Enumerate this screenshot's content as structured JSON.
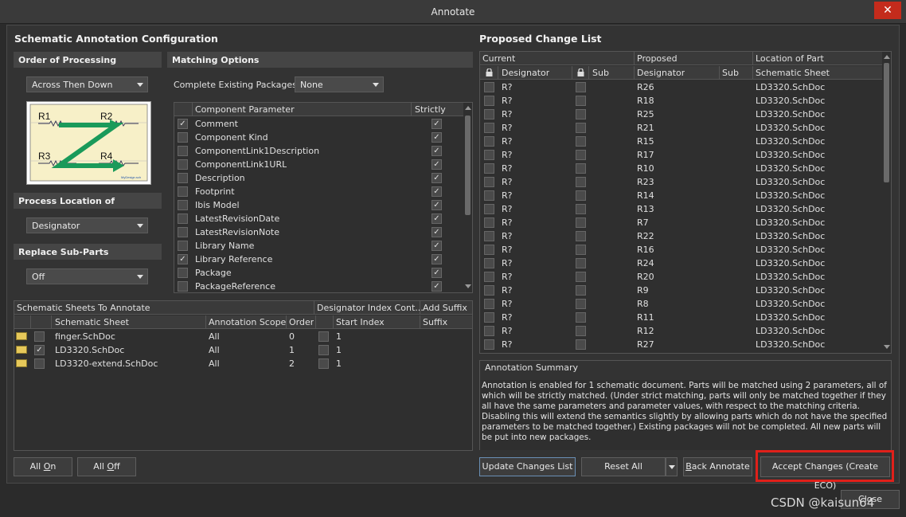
{
  "window": {
    "title": "Annotate",
    "close_glyph": "✕"
  },
  "left": {
    "title": "Schematic Annotation Configuration",
    "order": {
      "header": "Order of Processing",
      "value": "Across Then Down"
    },
    "preview": {
      "labels": [
        "R1",
        "R2",
        "R3",
        "R4"
      ],
      "caption": "MyDesign.sch"
    },
    "process_location": {
      "header": "Process Location of",
      "value": "Designator"
    },
    "replace_subparts": {
      "header": "Replace Sub-Parts",
      "value": "Off"
    },
    "matching": {
      "header": "Matching Options",
      "complete_label": "Complete Existing Packages",
      "complete_value": "None",
      "col_param": "Component Parameter",
      "col_strict": "Strictly",
      "params": [
        {
          "name": "Comment",
          "checked": true,
          "strict": true
        },
        {
          "name": "Component Kind",
          "checked": false,
          "strict": true
        },
        {
          "name": "ComponentLink1Description",
          "checked": false,
          "strict": true
        },
        {
          "name": "ComponentLink1URL",
          "checked": false,
          "strict": true
        },
        {
          "name": "Description",
          "checked": false,
          "strict": true
        },
        {
          "name": "Footprint",
          "checked": false,
          "strict": true
        },
        {
          "name": "Ibis Model",
          "checked": false,
          "strict": true
        },
        {
          "name": "LatestRevisionDate",
          "checked": false,
          "strict": true
        },
        {
          "name": "LatestRevisionNote",
          "checked": false,
          "strict": true
        },
        {
          "name": "Library Name",
          "checked": false,
          "strict": true
        },
        {
          "name": "Library Reference",
          "checked": true,
          "strict": true
        },
        {
          "name": "Package",
          "checked": false,
          "strict": true
        },
        {
          "name": "PackageReference",
          "checked": false,
          "strict": true
        }
      ]
    },
    "sheets": {
      "group1": "Schematic Sheets To Annotate",
      "group2": "Designator Index Cont...",
      "group3": "Add Suffix",
      "col_sheet": "Schematic Sheet",
      "col_scope": "Annotation Scope",
      "col_order": "Order",
      "col_start": "Start Index",
      "col_suffix": "Suffix",
      "rows": [
        {
          "sheet": "finger.SchDoc",
          "checked": false,
          "scope": "All",
          "order": "0",
          "start": "1"
        },
        {
          "sheet": "LD3320.SchDoc",
          "checked": true,
          "scope": "All",
          "order": "1",
          "start": "1"
        },
        {
          "sheet": "LD3320-extend.SchDoc",
          "checked": false,
          "scope": "All",
          "order": "2",
          "start": "1"
        }
      ]
    },
    "buttons": {
      "all_on_pre": "All ",
      "all_on_u": "O",
      "all_on_post": "n",
      "all_off_pre": "All ",
      "all_off_u": "O",
      "all_off_post": "ff"
    }
  },
  "right": {
    "title": "Proposed Change List",
    "groups": {
      "current": "Current",
      "proposed": "Proposed",
      "location": "Location of Part"
    },
    "cols": {
      "designator": "Designator",
      "sub": "Sub",
      "pdesignator": "Designator",
      "psub": "Sub",
      "sheet": "Schematic Sheet"
    },
    "rows": [
      {
        "cur": "R?",
        "prop": "R26",
        "sheet": "LD3320.SchDoc"
      },
      {
        "cur": "R?",
        "prop": "R18",
        "sheet": "LD3320.SchDoc"
      },
      {
        "cur": "R?",
        "prop": "R25",
        "sheet": "LD3320.SchDoc"
      },
      {
        "cur": "R?",
        "prop": "R21",
        "sheet": "LD3320.SchDoc"
      },
      {
        "cur": "R?",
        "prop": "R15",
        "sheet": "LD3320.SchDoc"
      },
      {
        "cur": "R?",
        "prop": "R17",
        "sheet": "LD3320.SchDoc"
      },
      {
        "cur": "R?",
        "prop": "R10",
        "sheet": "LD3320.SchDoc"
      },
      {
        "cur": "R?",
        "prop": "R23",
        "sheet": "LD3320.SchDoc"
      },
      {
        "cur": "R?",
        "prop": "R14",
        "sheet": "LD3320.SchDoc"
      },
      {
        "cur": "R?",
        "prop": "R13",
        "sheet": "LD3320.SchDoc"
      },
      {
        "cur": "R?",
        "prop": "R7",
        "sheet": "LD3320.SchDoc"
      },
      {
        "cur": "R?",
        "prop": "R22",
        "sheet": "LD3320.SchDoc"
      },
      {
        "cur": "R?",
        "prop": "R16",
        "sheet": "LD3320.SchDoc"
      },
      {
        "cur": "R?",
        "prop": "R24",
        "sheet": "LD3320.SchDoc"
      },
      {
        "cur": "R?",
        "prop": "R20",
        "sheet": "LD3320.SchDoc"
      },
      {
        "cur": "R?",
        "prop": "R9",
        "sheet": "LD3320.SchDoc"
      },
      {
        "cur": "R?",
        "prop": "R8",
        "sheet": "LD3320.SchDoc"
      },
      {
        "cur": "R?",
        "prop": "R11",
        "sheet": "LD3320.SchDoc"
      },
      {
        "cur": "R?",
        "prop": "R12",
        "sheet": "LD3320.SchDoc"
      },
      {
        "cur": "R?",
        "prop": "R27",
        "sheet": "LD3320.SchDoc"
      }
    ],
    "summary": {
      "header": "Annotation Summary",
      "text": "Annotation is enabled for 1 schematic document. Parts will be matched using 2 parameters, all of which will be strictly matched. (Under strict matching, parts will only be matched together if they all have the same parameters and parameter values, with respect to the matching criteria. Disabling this will extend the semantics slightly by allowing parts which do not have the specified parameters to be matched together.) Existing packages will not be completed. All new parts will be put into new packages."
    },
    "buttons": {
      "update": "Update Changes List",
      "reset": "Reset All",
      "back_u": "B",
      "back_rest": "ack Annotate",
      "accept": "Accept Changes (Create ECO)",
      "close": "Close"
    }
  },
  "watermark": "CSDN @kaisun64",
  "colors": {
    "highlight": "#e0201a",
    "accent": "#1a9a5a"
  }
}
